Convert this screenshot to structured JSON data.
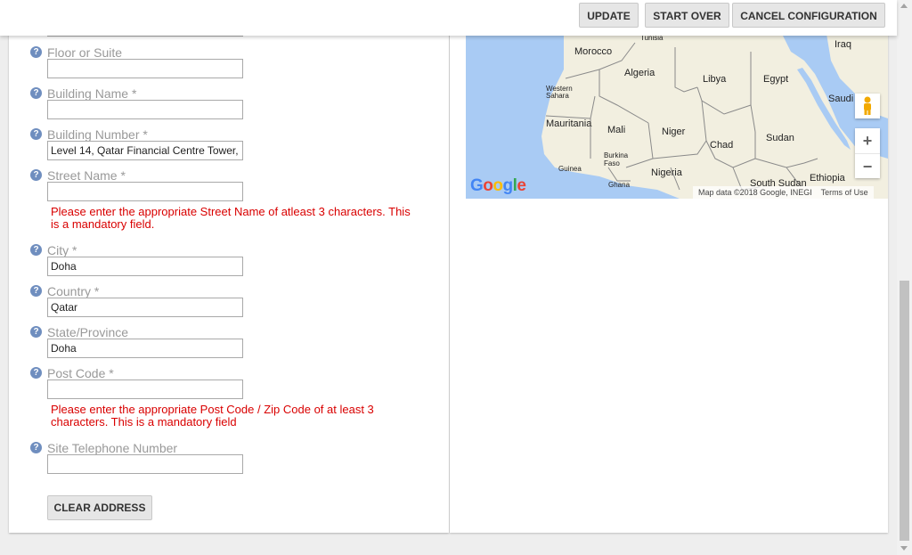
{
  "toolbar": {
    "update_label": "UPDATE",
    "start_over_label": "START OVER",
    "cancel_label": "CANCEL CONFIGURATION"
  },
  "form": {
    "fields": [
      {
        "label": "Floor or Suite",
        "value": ""
      },
      {
        "label": "Building Name *",
        "value": ""
      },
      {
        "label": "Building Number *",
        "value": "Level 14, Qatar Financial Centre Tower,"
      },
      {
        "label": "Street Name *",
        "value": "",
        "error": "Please enter the appropriate Street Name of atleast 3 characters. This is a mandatory field."
      },
      {
        "label": "City *",
        "value": "Doha"
      },
      {
        "label": "Country *",
        "value": "Qatar"
      },
      {
        "label": "State/Province",
        "value": "Doha"
      },
      {
        "label": "Post Code *",
        "value": "",
        "error": "Please enter the appropriate Post Code / Zip Code of at least 3 characters. This is a mandatory field"
      },
      {
        "label": "Site Telephone Number",
        "value": ""
      }
    ],
    "help_glyph": "?",
    "clear_label": "CLEAR ADDRESS"
  },
  "map": {
    "labels": {
      "tunisia": "Tunisia",
      "morocco": "Morocco",
      "algeria": "Algeria",
      "libya": "Libya",
      "egypt": "Egypt",
      "iraq": "Iraq",
      "western_sahara": "Western Sahara",
      "saudi": "Saudi",
      "mauritania": "Mauritania",
      "mali": "Mali",
      "niger": "Niger",
      "chad": "Chad",
      "sudan": "Sudan",
      "burkina": "Burkina Faso",
      "guinea": "Guinea",
      "nigeria": "Nigeria",
      "ghana": "Ghana",
      "south_sudan": "South Sudan",
      "ethiopia": "Ethiopia"
    },
    "logo": "Google",
    "attribution": "Map data ©2018 Google, INEGI",
    "terms": "Terms of Use",
    "zoom_in": "+",
    "zoom_out": "−",
    "colors": {
      "water": "#a9cbf4",
      "land": "#f2efe0",
      "border": "#8a8a8a"
    }
  }
}
